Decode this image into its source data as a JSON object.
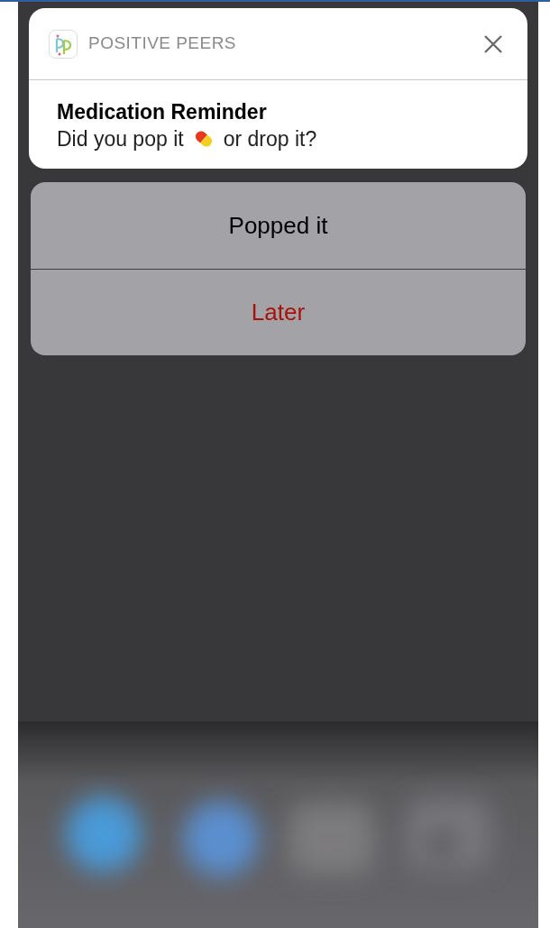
{
  "notification": {
    "app_name": "POSITIVE PEERS",
    "title": "Medication Reminder",
    "body_before": "Did you pop it",
    "body_after": "or drop it?"
  },
  "actions": [
    {
      "label": "Popped it",
      "kind": "default"
    },
    {
      "label": "Later",
      "kind": "destructive"
    }
  ]
}
